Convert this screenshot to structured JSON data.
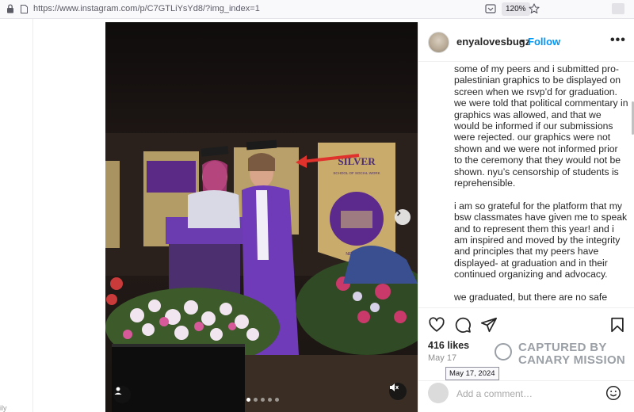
{
  "browser": {
    "url_main": "https://www.instagram.com",
    "url_path": "/p/C7GTLiYsYd8/?img_index=1",
    "zoom": "120%"
  },
  "left_strip": {
    "edge_text": "ily"
  },
  "post": {
    "username": "enyalovesbugz",
    "separator": "•",
    "follow_label": "Follow",
    "more_label": "•••",
    "caption": [
      "some of my peers and i submitted pro-palestinian graphics to be displayed on screen when we rsvp’d for graduation. we were told that political commentary in graphics was allowed, and that we would be informed if our submissions were rejected. our graphics were not shown and we were not informed prior to the ceremony that they would not be shown. nyu’s censorship of students is reprehensible.",
      "i am so grateful for the platform that my bsw classmates have given me to speak and to represent them this year! and i am inspired and moved by the integrity and principles that my peers have displayed- at graduation and in their continued organizing and advocacy.",
      "we graduated, but there are no safe"
    ],
    "likes": "416 likes",
    "date": "May 17",
    "date_tooltip": "May 17, 2024",
    "comment_placeholder": "Add a comment…"
  },
  "photo": {
    "banner_text_left": "SILVER",
    "banner_text_sub": "SCHOOL OF SOCIAL WORK",
    "banner_text_bottom": "NEW YORK",
    "slide_count": 5,
    "active_slide": 1
  },
  "watermark": {
    "line1": "CAPTURED BY",
    "line2": "CANARY MISSION"
  },
  "colors": {
    "follow_blue": "#0095f6",
    "nyu_purple": "#57068c",
    "arrow_red": "#e0322c"
  },
  "icons": [
    "lock-icon",
    "page-icon",
    "download-icon",
    "star-icon",
    "extension-icon",
    "chevron-right-icon",
    "user-tag-icon",
    "mute-icon",
    "heart-icon",
    "comment-icon",
    "share-icon",
    "bookmark-icon",
    "emoji-icon"
  ]
}
